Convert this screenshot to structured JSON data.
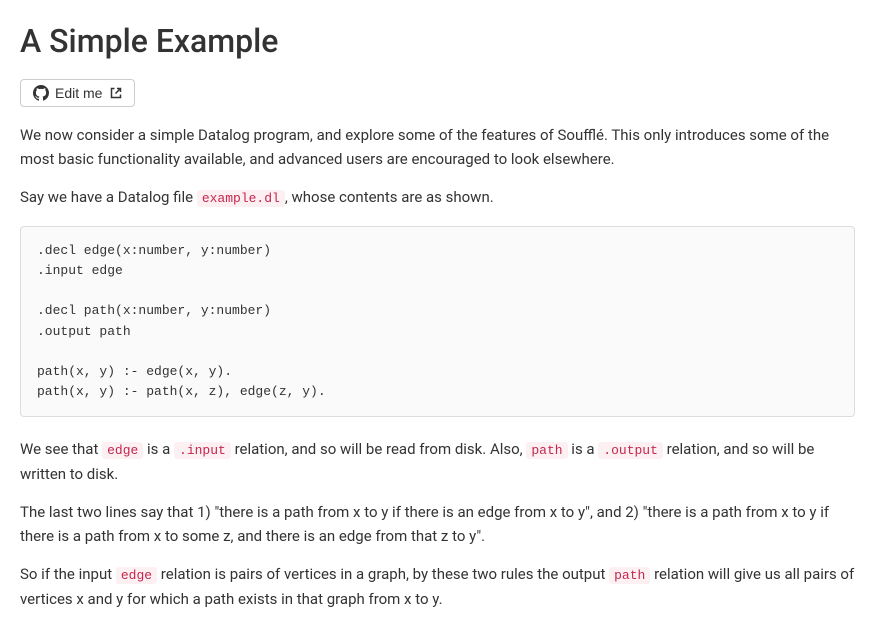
{
  "title": "A Simple Example",
  "edit_button": "Edit me",
  "paragraphs": {
    "intro": "We now consider a simple Datalog program, and explore some of the features of Soufflé. This only introduces some of the most basic functionality available, and advanced users are encouraged to look elsewhere.",
    "say_prefix": "Say we have a Datalog file ",
    "say_suffix": ", whose contents are as shown.",
    "example_file": "example.dl",
    "code_block": ".decl edge(x:number, y:number)\n.input edge\n\n.decl path(x:number, y:number)\n.output path\n\npath(x, y) :- edge(x, y).\npath(x, y) :- path(x, z), edge(z, y).",
    "we_see_1": "We see that ",
    "edge": "edge",
    "we_see_2": " is a ",
    "input": ".input",
    "we_see_3": " relation, and so will be read from disk. Also, ",
    "path": "path",
    "we_see_4": " is a ",
    "output": ".output",
    "we_see_5": " relation, and so will be written to disk.",
    "last_two": "The last two lines say that 1) \"there is a path from x to y if there is an edge from x to y\", and 2) \"there is a path from x to y if there is a path from x to some z, and there is an edge from that z to y\".",
    "so_if_1": "So if the input ",
    "so_if_2": " relation is pairs of vertices in a graph, by these two rules the output ",
    "so_if_3": " relation will give us all pairs of vertices x and y for which a path exists in that graph from x to y."
  }
}
